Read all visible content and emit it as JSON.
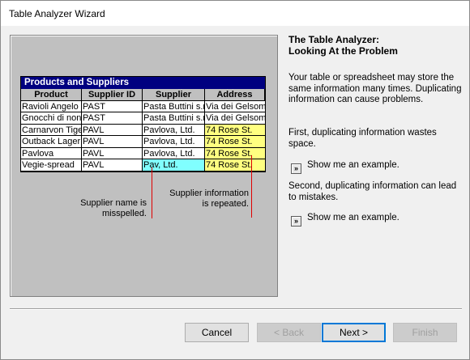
{
  "window": {
    "title": "Table Analyzer Wizard"
  },
  "illustration": {
    "table_caption": "Products and Suppliers",
    "columns": [
      "Product",
      "Supplier ID",
      "Supplier",
      "Address"
    ],
    "rows": [
      [
        "Ravioli Angelo",
        "PAST",
        "Pasta Buttini s.r.l.",
        "Via dei Gelsomini"
      ],
      [
        "Gnocchi di nonna",
        "PAST",
        "Pasta Buttini s.r.l.",
        "Via dei Gelsomini"
      ],
      [
        "Carnarvon Tigers",
        "PAVL",
        "Pavlova, Ltd.",
        "74 Rose St."
      ],
      [
        "Outback Lager",
        "PAVL",
        "Pavlova, Ltd.",
        "74 Rose St."
      ],
      [
        "Pavlova",
        "PAVL",
        "Pavlova, Ltd.",
        "74 Rose St."
      ],
      [
        "Vegie-spread",
        "PAVL",
        "Pav, Ltd.",
        "74 Rose St."
      ]
    ],
    "note_misspelled": "Supplier name is misspelled.",
    "note_repeated": "Supplier information is repeated.",
    "colors": {
      "yellow_highlight": "#ffff80",
      "cyan_highlight": "#80ffff",
      "callout_line": "#e00000"
    }
  },
  "panel": {
    "heading_line1": "The Table Analyzer:",
    "heading_line2": "Looking At the Problem",
    "intro": "Your table or spreadsheet may store the same information many times. Duplicating information can cause problems.",
    "first_point": "First, duplicating information wastes space.",
    "example_label_1": "Show me an example.",
    "second_point": "Second, duplicating information can lead to mistakes.",
    "example_label_2": "Show me an example.",
    "example_btn_glyph": "»"
  },
  "buttons": {
    "cancel": "Cancel",
    "back": "< Back",
    "next": "Next >",
    "finish": "Finish"
  }
}
